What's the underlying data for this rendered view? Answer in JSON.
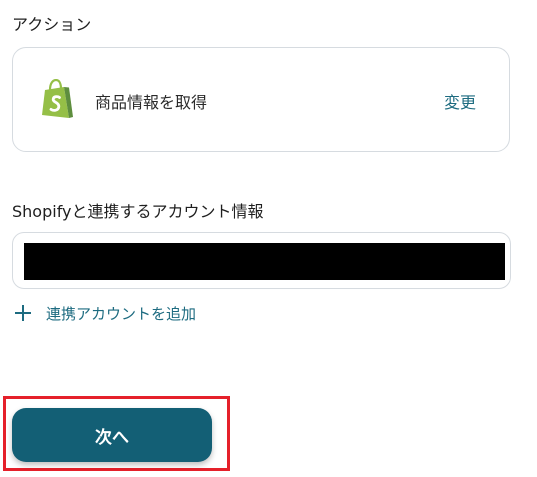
{
  "action_section": {
    "label": "アクション",
    "app_icon": "shopify-bag-icon",
    "action_name": "商品情報を取得",
    "change_label": "変更"
  },
  "account_section": {
    "label": "Shopifyと連携するアカウント情報",
    "value_redacted": true,
    "add_account_label": "連携アカウントを追加"
  },
  "footer": {
    "next_label": "次へ"
  },
  "colors": {
    "accent": "#1d6b80",
    "button_bg": "#135f75",
    "highlight": "#e5202a",
    "shopify_green": "#95bf47",
    "shopify_dark_green": "#5e8e3e"
  }
}
